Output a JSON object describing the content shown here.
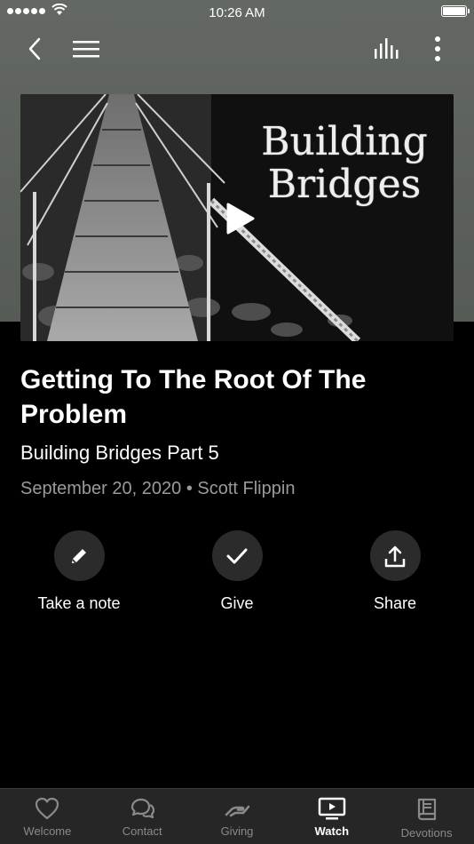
{
  "status_bar": {
    "time": "10:26 AM"
  },
  "video": {
    "artwork_title": "Building\nBridges"
  },
  "sermon": {
    "title": "Getting To The Root Of The Problem",
    "series": "Building Bridges Part 5",
    "date": "September 20, 2020",
    "separator": "•",
    "speaker": "Scott Flippin"
  },
  "actions": [
    {
      "label": "Take a note",
      "icon": "pencil-icon"
    },
    {
      "label": "Give",
      "icon": "check-icon"
    },
    {
      "label": "Share",
      "icon": "share-icon"
    }
  ],
  "tabs": [
    {
      "label": "Welcome",
      "icon": "heart-icon",
      "active": false
    },
    {
      "label": "Contact",
      "icon": "chat-bubbles-icon",
      "active": false
    },
    {
      "label": "Giving",
      "icon": "giving-hand-icon",
      "active": false
    },
    {
      "label": "Watch",
      "icon": "tv-play-icon",
      "active": true
    },
    {
      "label": "Devotions",
      "icon": "book-icon",
      "active": false
    }
  ],
  "colors": {
    "header_bg": "#5f645f",
    "background": "#000000",
    "tabbar_bg": "#262626",
    "muted_text": "#9a9a9a"
  }
}
